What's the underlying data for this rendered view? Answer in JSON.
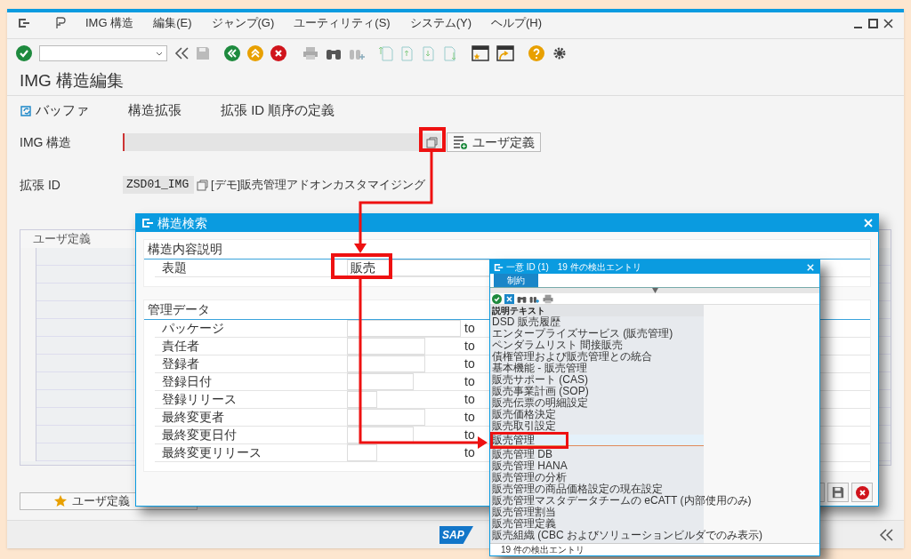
{
  "menu": [
    {
      "label": "IMG 構造"
    },
    {
      "label": "編集(E)"
    },
    {
      "label": "ジャンプ(G)"
    },
    {
      "label": "ユーティリティ(S)"
    },
    {
      "label": "システム(Y)"
    },
    {
      "label": "ヘルプ(H)"
    }
  ],
  "title": "IMG 構造編集",
  "app_toolbar": [
    {
      "label": "バッファ",
      "kind": "icon_text"
    },
    {
      "label": "構造拡張",
      "kind": "text"
    },
    {
      "label": "拡張 ID 順序の定義",
      "kind": "text"
    }
  ],
  "fields": [
    {
      "label": "IMG 構造",
      "kind": "required",
      "button": "ユーザ定義"
    },
    {
      "label": "拡張 ID",
      "kind": "display",
      "value": "ZSD01_IMG",
      "description": "[デモ]販売管理アドオンカスタマイジング"
    }
  ],
  "table": {
    "columns": [
      "ユーザ定義"
    ]
  },
  "footer_button": "ユーザ定義",
  "status_bar": {
    "logo": "SAP"
  },
  "dialog": {
    "title": "構造検索",
    "groups": [
      {
        "title": "構造内容説明",
        "rows": [
          {
            "label": "表題",
            "value": "販売"
          }
        ]
      },
      {
        "title": "管理データ",
        "rows": [
          {
            "label": "パッケージ",
            "to": "to"
          },
          {
            "label": "責任者",
            "to": "to"
          },
          {
            "label": "登録者",
            "to": "to"
          },
          {
            "label": "登録日付",
            "to": "to"
          },
          {
            "label": "登録リリース",
            "to": "to"
          },
          {
            "label": "最終変更者",
            "to": "to"
          },
          {
            "label": "最終変更日付",
            "to": "to"
          },
          {
            "label": "最終変更リリース",
            "to": "to"
          }
        ]
      }
    ]
  },
  "popup": {
    "title": "一意 ID (1)　19 件の検出エントリ",
    "tabs": [
      {
        "label": "制約",
        "selected": true
      }
    ],
    "column": "説明テキスト",
    "rows": [
      {
        "text": "DSD 販売履歴",
        "selected": false
      },
      {
        "text": "エンタープライズサービス (販売管理)",
        "selected": false
      },
      {
        "text": "ペンダラムリスト 間接販売",
        "selected": false
      },
      {
        "text": "債権管理および販売管理との統合",
        "selected": false
      },
      {
        "text": "基本機能 - 販売管理",
        "selected": false
      },
      {
        "text": "販売サポート (CAS)",
        "selected": false
      },
      {
        "text": "販売事業計画 (SOP)",
        "selected": false
      },
      {
        "text": "販売伝票の明細設定",
        "selected": false
      },
      {
        "text": "販売価格決定",
        "selected": false
      },
      {
        "text": "販売取引設定",
        "selected": false
      },
      {
        "text": "販売管理",
        "selected": true
      },
      {
        "text": "販売管理 DB",
        "selected": false
      },
      {
        "text": "販売管理 HANA",
        "selected": false
      },
      {
        "text": "販売管理の分析",
        "selected": false
      },
      {
        "text": "販売管理の商品価格設定の現在設定",
        "selected": false
      },
      {
        "text": "販売管理マスタデータチームの eCATT (内部使用のみ)",
        "selected": false
      },
      {
        "text": "販売管理割当",
        "selected": false
      },
      {
        "text": "販売管理定義",
        "selected": false
      },
      {
        "text": "販売組織 (CBC およびソリューションビルダでのみ表示)",
        "selected": false
      }
    ],
    "status": "19 件の検出エントリ"
  }
}
